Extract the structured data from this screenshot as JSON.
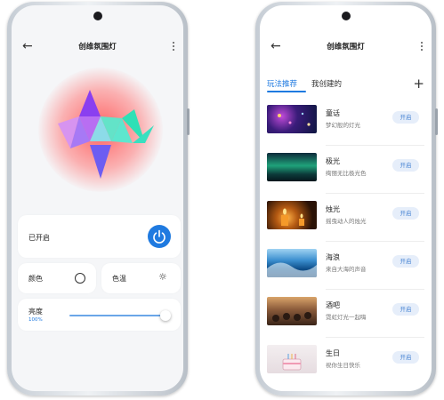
{
  "left_screen": {
    "title": "创维氛围灯",
    "power_label": "已开启",
    "color_label": "颜色",
    "temp_label": "色温",
    "brightness_label": "亮度",
    "brightness_value": "100%",
    "brightness_level": 1.0
  },
  "right_screen": {
    "title": "创维氛围灯",
    "tabs": [
      "玩法推荐",
      "我创建的"
    ],
    "items": [
      {
        "name": "童话",
        "desc": "梦幻般的灯光",
        "button": "开启"
      },
      {
        "name": "极光",
        "desc": "绚丽无比极光色",
        "button": "开启"
      },
      {
        "name": "烛光",
        "desc": "摇曳动人的烛光",
        "button": "开启"
      },
      {
        "name": "海浪",
        "desc": "来自大海的声音",
        "button": "开启"
      },
      {
        "name": "酒吧",
        "desc": "霓虹灯光一起嗨",
        "button": "开启"
      },
      {
        "name": "生日",
        "desc": "祝你生日快乐",
        "button": "开启"
      }
    ]
  },
  "icons": [
    "back-arrow-icon",
    "more-vertical-icon",
    "power-icon",
    "color-circle-icon",
    "sun-icon",
    "plus-icon"
  ],
  "colors": {
    "accent": "#1f7ae0",
    "glow": "#ff5a5a",
    "background": "#f5f6f8"
  }
}
